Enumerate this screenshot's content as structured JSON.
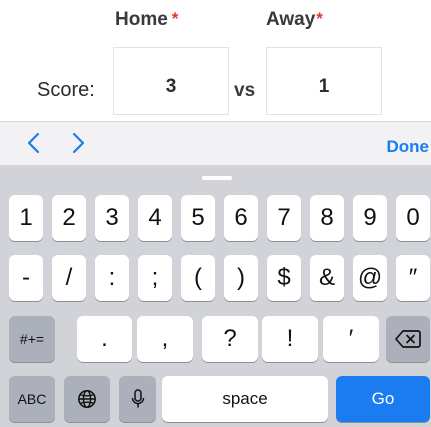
{
  "form": {
    "home_label": "Home",
    "away_label": "Away",
    "required_mark": "*",
    "score_label": "Score:",
    "vs_label": "vs",
    "home_score": "3",
    "away_score": "1"
  },
  "accessory": {
    "prev_icon": "chevron-left-icon",
    "next_icon": "chevron-right-icon",
    "done_label": "Done"
  },
  "keyboard": {
    "row1": [
      "1",
      "2",
      "3",
      "4",
      "5",
      "6",
      "7",
      "8",
      "9",
      "0"
    ],
    "row2": [
      "-",
      "/",
      ":",
      ";",
      "(",
      ")",
      "$",
      "&",
      "@",
      "″"
    ],
    "row3": {
      "mode_label": "#+=",
      "keys": [
        ".",
        ",",
        "?",
        "!",
        "′"
      ],
      "delete_icon": "backspace-icon"
    },
    "row4": {
      "abc_label": "ABC",
      "globe_icon": "globe-icon",
      "mic_icon": "microphone-icon",
      "space_label": "space",
      "go_label": "Go"
    }
  },
  "colors": {
    "accent": "#1a7cf0",
    "required": "#e5332a",
    "keyboard_bg": "#d1d3d9",
    "special_key": "#abb0ba"
  }
}
